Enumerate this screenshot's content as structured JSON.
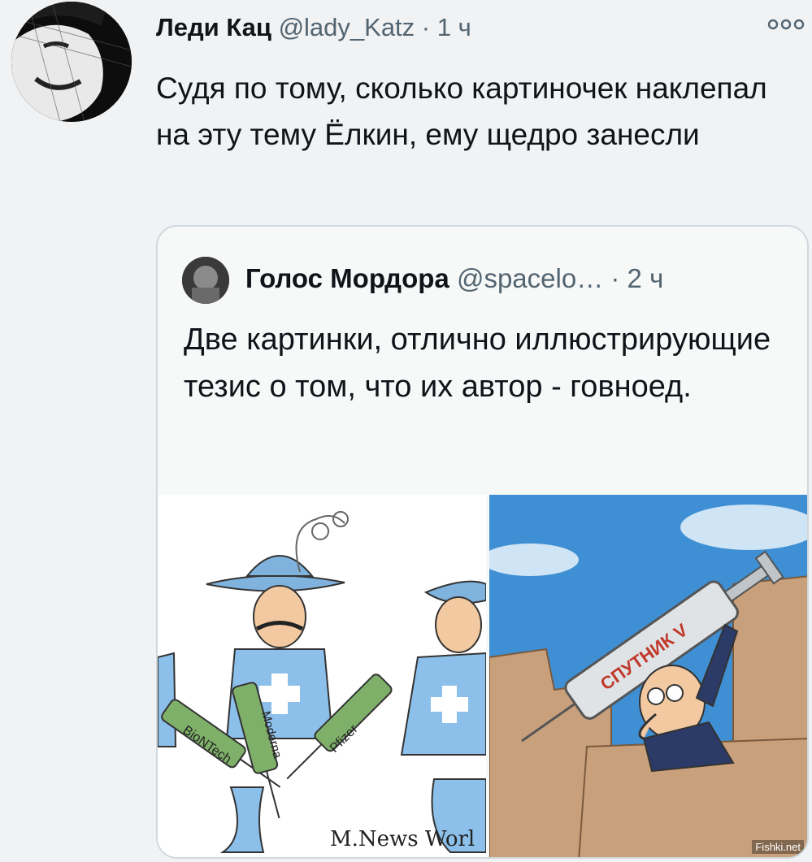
{
  "tweet": {
    "author_name": "Леди Кац",
    "author_handle": "@lady_Katz",
    "separator": "·",
    "time": "1 ч",
    "more_icon": "more-dots-icon",
    "text": "Судя по тому, сколько картиночек наклепал на эту тему Ёлкин, ему щедро занесли"
  },
  "quote": {
    "author_name": "Голос Мордора",
    "author_handle": "@spacelo…",
    "separator": "·",
    "time": "2 ч",
    "text": "Две картинки, отлично иллюстрирующие тезис о том, что их автор - говноед."
  },
  "images": {
    "left": {
      "labels": [
        "BioNTech",
        "Moderna",
        "Pfizer"
      ],
      "signature": "M.News Worl"
    },
    "right": {
      "label": "СПУТНИК V"
    }
  },
  "watermark": "Fishki.net"
}
